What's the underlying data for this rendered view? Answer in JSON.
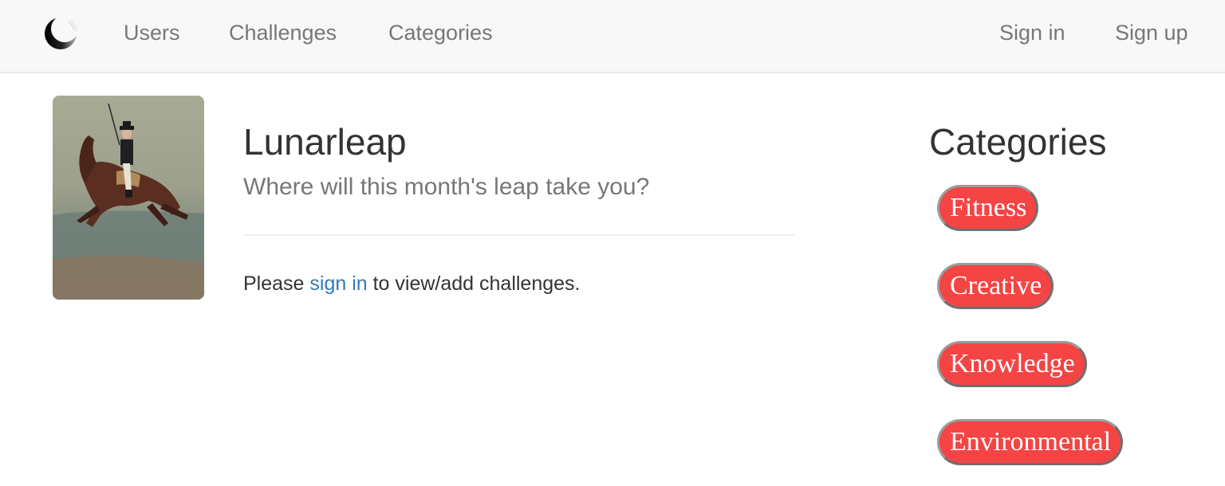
{
  "navbar": {
    "brand_icon": "crescent-moon-icon",
    "links": [
      {
        "label": "Users"
      },
      {
        "label": "Challenges"
      },
      {
        "label": "Categories"
      }
    ],
    "auth": {
      "sign_in": "Sign in",
      "sign_up": "Sign up"
    }
  },
  "hero": {
    "image_subject": "painting of a rider on a rearing horse",
    "title": "Lunarleap",
    "tagline": "Where will this month's leap take you?",
    "notice_prefix": "Please ",
    "notice_link": "sign in",
    "notice_suffix": " to view/add challenges."
  },
  "sidebar": {
    "title": "Categories",
    "categories": [
      {
        "label": "Fitness"
      },
      {
        "label": "Creative"
      },
      {
        "label": "Knowledge"
      },
      {
        "label": "Environmental"
      }
    ]
  },
  "colors": {
    "navbar_bg": "#f8f8f8",
    "link": "#337ab7",
    "category_pill": "#f44444",
    "muted_text": "#777777"
  }
}
